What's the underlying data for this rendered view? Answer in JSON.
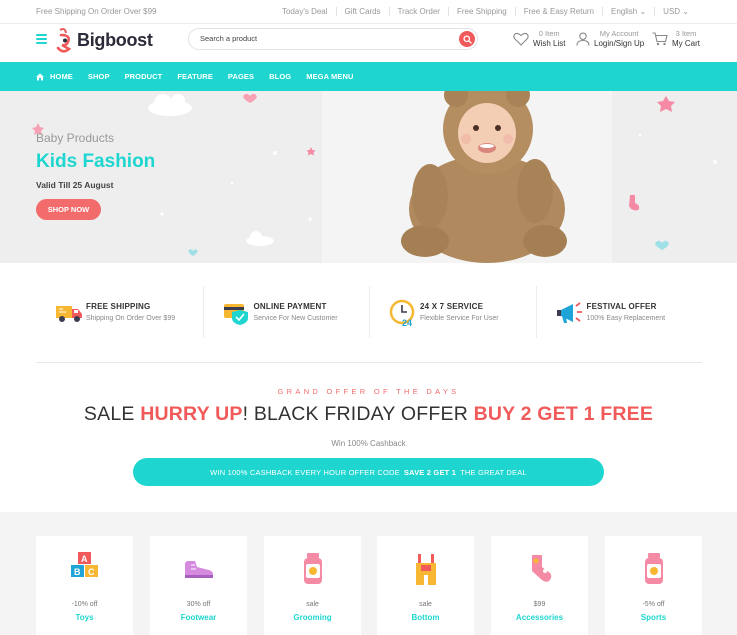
{
  "topbar": {
    "promo": "Free Shipping On Order Over $99",
    "links": [
      "Today's Deal",
      "Gift Cards",
      "Track Order",
      "Free Shipping",
      "Free & Easy Return",
      "English ⌄",
      "USD ⌄"
    ]
  },
  "header": {
    "logo": "Bigboost",
    "search_placeholder": "Search a product",
    "wishlist": {
      "count": "0 Item",
      "label": "Wish List"
    },
    "account": {
      "title": "My Account",
      "label": "Login/Sign Up"
    },
    "cart": {
      "count": "3 Item",
      "label": "My Cart"
    }
  },
  "nav": {
    "items": [
      "HOME",
      "SHOP",
      "PRODUCT",
      "FEATURE",
      "PAGES",
      "BLOG",
      "MEGA MENU"
    ]
  },
  "hero": {
    "subtitle": "Baby Products",
    "title": "Kids Fashion",
    "valid": "Valid Till 25 August",
    "button": "SHOP NOW"
  },
  "features": [
    {
      "title": "FREE SHIPPING",
      "sub": "Shipping On Order Over $99",
      "icon": "truck-icon"
    },
    {
      "title": "ONLINE PAYMENT",
      "sub": "Service For New Customer",
      "icon": "card-shield-icon"
    },
    {
      "title": "24 X 7 SERVICE",
      "sub": "Flexible Service For User",
      "icon": "clock-24-icon"
    },
    {
      "title": "FESTIVAL OFFER",
      "sub": "100% Easy Replacement",
      "icon": "megaphone-icon"
    }
  ],
  "offer": {
    "eyebrow": "GRAND OFFER OF THE DAYS",
    "sale_1": "SALE ",
    "sale_2": "HURRY UP",
    "sale_3": "! BLACK FRIDAY OFFER ",
    "sale_4": "BUY 2 GET 1 FREE",
    "cashback": "Win 100% Cashback",
    "banner_1": "WIN 100% CASHBACK EVERY HOUR OFFER CODE",
    "banner_2": "SAVE 2 GET 1",
    "banner_3": "THE GREAT DEAL"
  },
  "categories": [
    {
      "discount": "-10% off",
      "name": "Toys",
      "icon": "abc-blocks-icon"
    },
    {
      "discount": "30% off",
      "name": "Footwear",
      "icon": "shoe-icon"
    },
    {
      "discount": "sale",
      "name": "Grooming",
      "icon": "baby-bottle-icon"
    },
    {
      "discount": "sale",
      "name": "Bottom",
      "icon": "overalls-icon"
    },
    {
      "discount": "$99",
      "name": "Accessories",
      "icon": "socks-icon"
    },
    {
      "discount": "-5% off",
      "name": "Sports",
      "icon": "baby-jar-icon"
    }
  ],
  "colors": {
    "accent": "#1ed6cf",
    "red": "#f15a5a",
    "pink": "#f26c6c"
  }
}
